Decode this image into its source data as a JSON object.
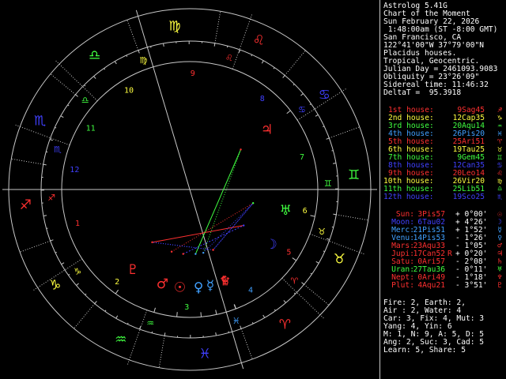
{
  "header": [
    "Astrolog 5.41G",
    "Chart of the Moment",
    "Sun February 22, 2026",
    " 1:48:00am (ST -8:00 GMT)",
    "San Francisco, CA",
    "122°41'00\"W 37°79'00\"N",
    "Placidus houses.",
    "Tropical, Geocentric.",
    "Julian Day = 2461093.9083",
    "Obliquity = 23°26'09\"",
    "Sidereal time: 11:46:32",
    "DeltaT =  95.3918"
  ],
  "houses": [
    {
      "label": "1st house:",
      "value": "9Sag45",
      "color": "#ff3030",
      "symbol": "♐"
    },
    {
      "label": "2nd house:",
      "value": "12Cap35",
      "color": "#ffff40",
      "symbol": "♑"
    },
    {
      "label": "3rd house:",
      "value": "20Aqu14",
      "color": "#40ff40",
      "symbol": "♒"
    },
    {
      "label": "4th house:",
      "value": "26Pis20",
      "color": "#40a0ff",
      "symbol": "♓"
    },
    {
      "label": "5th house:",
      "value": "25Ari51",
      "color": "#ff3030",
      "symbol": "♈"
    },
    {
      "label": "6th house:",
      "value": "19Tau25",
      "color": "#ffff40",
      "symbol": "♉"
    },
    {
      "label": "7th house:",
      "value": "9Gem45",
      "color": "#40ff40",
      "symbol": "♊"
    },
    {
      "label": "8th house:",
      "value": "12Can35",
      "color": "#4040ff",
      "symbol": "♋"
    },
    {
      "label": "9th house:",
      "value": "20Leo14",
      "color": "#ff3030",
      "symbol": "♌"
    },
    {
      "label": "10th house:",
      "value": "26Vir20",
      "color": "#ffff40",
      "symbol": "♍"
    },
    {
      "label": "11th house:",
      "value": "25Lib51",
      "color": "#40ff40",
      "symbol": "♎"
    },
    {
      "label": "12th house:",
      "value": "19Sco25",
      "color": "#4040ff",
      "symbol": "♏"
    }
  ],
  "planets": [
    {
      "name": "Sun:",
      "pos": "3Pis57",
      "flag": " ",
      "decl": "+ 0°00'",
      "color": "#ff3030",
      "symbol": "☉"
    },
    {
      "name": "Moon:",
      "pos": "6Tau02",
      "flag": " ",
      "decl": "+ 4°26'",
      "color": "#4040ff",
      "symbol": "☽"
    },
    {
      "name": "Merc:",
      "pos": "21Pis51",
      "flag": " ",
      "decl": "+ 1°52'",
      "color": "#40a0ff",
      "symbol": "☿"
    },
    {
      "name": "Venu:",
      "pos": "14Pis53",
      "flag": " ",
      "decl": "- 1°26'",
      "color": "#40a0ff",
      "symbol": "♀"
    },
    {
      "name": "Mars:",
      "pos": "23Aqu33",
      "flag": " ",
      "decl": "- 1°05'",
      "color": "#ff3030",
      "symbol": "♂"
    },
    {
      "name": "Jupi:",
      "pos": "17Can52",
      "flag": "R",
      "decl": "+ 0°20'",
      "color": "#ff3030",
      "symbol": "♃"
    },
    {
      "name": "Satu:",
      "pos": "0Ari57",
      "flag": " ",
      "decl": "- 2°08'",
      "color": "#ff3030",
      "symbol": "♄"
    },
    {
      "name": "Uran:",
      "pos": "27Tau36",
      "flag": " ",
      "decl": "- 0°11'",
      "color": "#40ff40",
      "symbol": "♅"
    },
    {
      "name": "Nept:",
      "pos": "0Ari49",
      "flag": " ",
      "decl": "- 1°18'",
      "color": "#ff3030",
      "symbol": "♆"
    },
    {
      "name": "Plut:",
      "pos": "4Aqu21",
      "flag": " ",
      "decl": "- 3°51'",
      "color": "#ff3030",
      "symbol": "♇"
    }
  ],
  "summary": [
    "Fire: 2, Earth: 2,",
    "Air : 2, Water: 4",
    "Car: 3, Fix: 4, Mut: 3",
    "Yang: 4, Yin: 6",
    "M: 1, N: 9, A: 5, D: 5",
    "Ang: 2, Suc: 3, Cad: 5",
    "Learn: 5, Share: 5"
  ],
  "wheel": {
    "house_numbers": [
      "1",
      "2",
      "3",
      "4",
      "5",
      "6",
      "7",
      "8",
      "9",
      "10",
      "11",
      "12"
    ],
    "sign_glyphs": [
      "♈",
      "♉",
      "♊",
      "♋",
      "♌",
      "♍",
      "♎",
      "♏",
      "♐",
      "♑",
      "♒",
      "♓"
    ],
    "colors": {
      "fire": "#ff3030",
      "earth": "#ffff40",
      "air": "#40ff40",
      "water": "#4040ff",
      "line": "#c8c8c8"
    }
  }
}
